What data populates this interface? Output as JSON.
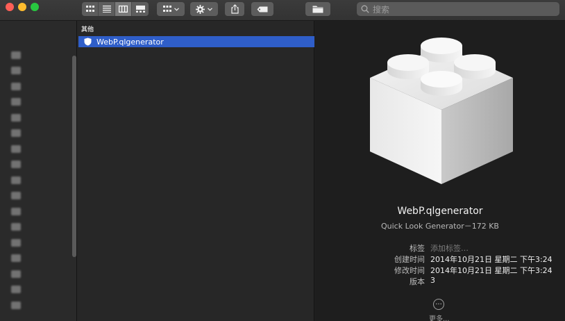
{
  "traffic_lights": {
    "close": "#ff5f57",
    "minimize": "#febc2e",
    "zoom": "#28c840"
  },
  "toolbar": {
    "view_modes": [
      {
        "icon": "icon-view-icon"
      },
      {
        "icon": "list-view-icon"
      },
      {
        "icon": "column-view-icon",
        "active": true
      },
      {
        "icon": "gallery-view-icon"
      }
    ],
    "search_placeholder": "搜索"
  },
  "column": {
    "header": "其他",
    "selected_item": "WebP.qlgenerator",
    "selection_color": "#2f5ec9"
  },
  "preview": {
    "file_name": "WebP.qlgenerator",
    "file_kind": "Quick Look Generator－172 KB",
    "metadata": [
      {
        "key": "标签",
        "value": "添加标签…",
        "placeholder": true
      },
      {
        "key": "创建时间",
        "value": "2014年10月21日 星期二 下午3:24"
      },
      {
        "key": "修改时间",
        "value": "2014年10月21日 星期二 下午3:24"
      },
      {
        "key": "版本",
        "value": "3"
      }
    ],
    "more_label": "更多..."
  }
}
